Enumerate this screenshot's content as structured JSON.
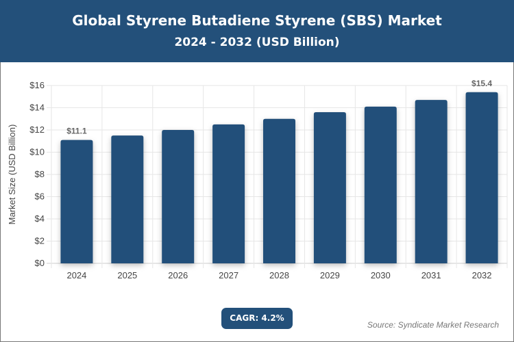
{
  "header": {
    "title": "Global Styrene Butadiene Styrene (SBS) Market",
    "subtitle": "2024 - 2032 (USD Billion)"
  },
  "chart_data": {
    "type": "bar",
    "title": "Global Styrene Butadiene Styrene (SBS) Market",
    "subtitle": "2024 - 2032 (USD Billion)",
    "categories": [
      "2024",
      "2025",
      "2026",
      "2027",
      "2028",
      "2029",
      "2030",
      "2031",
      "2032"
    ],
    "values": [
      11.1,
      11.5,
      12.0,
      12.5,
      13.0,
      13.6,
      14.1,
      14.7,
      15.4
    ],
    "data_labels": {
      "0": "$11.1",
      "8": "$15.4"
    },
    "ylabel": "Market Size (USD Billion)",
    "xlabel": "",
    "ylim": [
      0,
      16
    ],
    "yticks": [
      "$0",
      "$2",
      "$4",
      "$6",
      "$8",
      "$10",
      "$12",
      "$14",
      "$16"
    ],
    "grid": true,
    "bar_color": "#23507a"
  },
  "footer": {
    "cagr": "CAGR: 4.2%",
    "source": "Source: Syndicate Market Research"
  }
}
